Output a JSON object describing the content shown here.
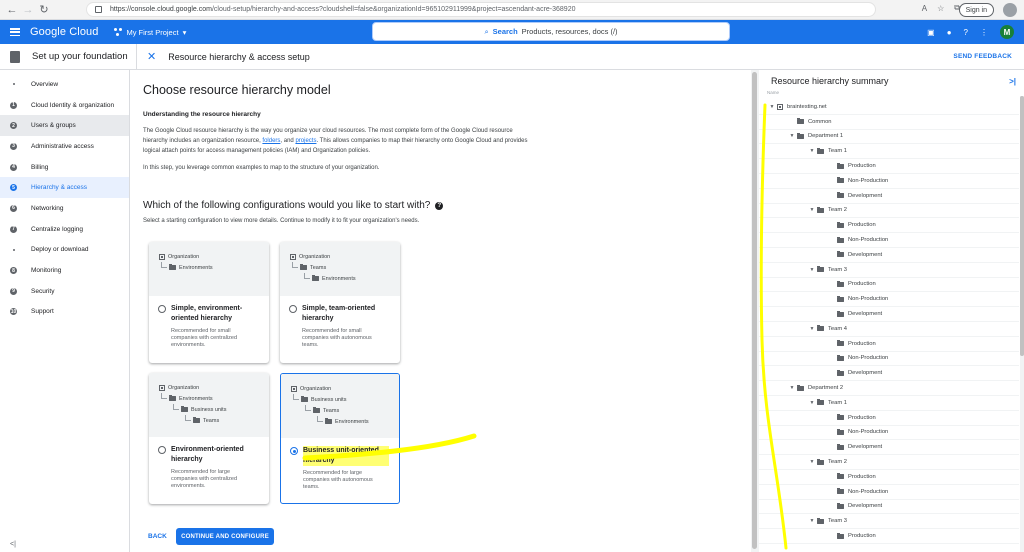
{
  "browser": {
    "url_main": "https://console.cloud.google.com",
    "url_rest": "/cloud-setup/hierarchy-and-access?cloudshell=false&organizationId=965102911999&project=ascendant-acre-368920",
    "signin_label": "Sign in"
  },
  "gcp": {
    "logo": "Google Cloud",
    "project": "My First Project",
    "search_label": "Search",
    "search_placeholder": "Products, resources, docs (/)",
    "avatar_letter": "M"
  },
  "header": {
    "foundation_title": "Set up your foundation",
    "setup_title": "Resource hierarchy & access setup",
    "feedback": "SEND FEEDBACK"
  },
  "sidebar": {
    "steps": [
      {
        "label": "Overview",
        "num": ""
      },
      {
        "label": "Cloud Identity & organization",
        "num": "1"
      },
      {
        "label": "Users & groups",
        "num": "2"
      },
      {
        "label": "Administrative access",
        "num": "3"
      },
      {
        "label": "Billing",
        "num": "4"
      },
      {
        "label": "Hierarchy & access",
        "num": "5"
      },
      {
        "label": "Networking",
        "num": "6"
      },
      {
        "label": "Centralize logging",
        "num": "7"
      },
      {
        "label": "Deploy or download",
        "num": ""
      },
      {
        "label": "Monitoring",
        "num": "8"
      },
      {
        "label": "Security",
        "num": "9"
      },
      {
        "label": "Support",
        "num": "10"
      }
    ],
    "collapse": "<|"
  },
  "main": {
    "title": "Choose resource hierarchy model",
    "understanding_heading": "Understanding the resource hierarchy",
    "para_1": "The Google Cloud resource hierarchy is the way you organize your cloud resources. The most complete form of the Google Cloud resource hierarchy includes an organization resource, ",
    "link_folders": "folders",
    "para_and": ", and ",
    "link_projects": "projects",
    "para_2": ". This allows companies to map their hierarchy onto Google Cloud and provides logical attach points for access management policies (IAM) and Organization policies.",
    "para_step": "In this step, you leverage common examples to map to the structure of your organization.",
    "question": "Which of the following configurations would you like to start with?",
    "question_desc": "Select a starting configuration to view more details. Continue to modify it to fit your organization's needs.",
    "cards": [
      {
        "title": "Simple, environment-oriented hierarchy",
        "desc": "Recommended for small companies with centralized environments.",
        "tree": [
          "Organization",
          "Environments"
        ]
      },
      {
        "title": "Simple, team-oriented hierarchy",
        "desc": "Recommended for small companies with autonomous teams.",
        "tree": [
          "Organization",
          "Teams",
          "Environments"
        ]
      },
      {
        "title": "Environment-oriented hierarchy",
        "desc": "Recommended for large companies with centralized environments.",
        "tree": [
          "Organization",
          "Environments",
          "Business units",
          "Teams"
        ]
      },
      {
        "title": "Business unit-oriented hierarchy",
        "desc": "Recommended for large companies with autonomous teams.",
        "tree": [
          "Organization",
          "Business units",
          "Teams",
          "Environments"
        ]
      }
    ],
    "back": "BACK",
    "continue": "CONTINUE AND CONFIGURE"
  },
  "summary": {
    "title": "Resource hierarchy summary",
    "name_header": "Name",
    "rows": [
      {
        "label": "braintesting.net",
        "level": 0,
        "type": "org",
        "expanded": true
      },
      {
        "label": "Common",
        "level": 1,
        "type": "folder",
        "expanded": false
      },
      {
        "label": "Department 1",
        "level": 1,
        "type": "folder",
        "expanded": true
      },
      {
        "label": "Team 1",
        "level": 2,
        "type": "folder",
        "expanded": true
      },
      {
        "label": "Production",
        "level": 3,
        "type": "folder",
        "expanded": false
      },
      {
        "label": "Non-Production",
        "level": 3,
        "type": "folder",
        "expanded": false
      },
      {
        "label": "Development",
        "level": 3,
        "type": "folder",
        "expanded": false
      },
      {
        "label": "Team 2",
        "level": 2,
        "type": "folder",
        "expanded": true
      },
      {
        "label": "Production",
        "level": 3,
        "type": "folder",
        "expanded": false
      },
      {
        "label": "Non-Production",
        "level": 3,
        "type": "folder",
        "expanded": false
      },
      {
        "label": "Development",
        "level": 3,
        "type": "folder",
        "expanded": false
      },
      {
        "label": "Team 3",
        "level": 2,
        "type": "folder",
        "expanded": true
      },
      {
        "label": "Production",
        "level": 3,
        "type": "folder",
        "expanded": false
      },
      {
        "label": "Non-Production",
        "level": 3,
        "type": "folder",
        "expanded": false
      },
      {
        "label": "Development",
        "level": 3,
        "type": "folder",
        "expanded": false
      },
      {
        "label": "Team 4",
        "level": 2,
        "type": "folder",
        "expanded": true
      },
      {
        "label": "Production",
        "level": 3,
        "type": "folder",
        "expanded": false
      },
      {
        "label": "Non-Production",
        "level": 3,
        "type": "folder",
        "expanded": false
      },
      {
        "label": "Development",
        "level": 3,
        "type": "folder",
        "expanded": false
      },
      {
        "label": "Department 2",
        "level": 1,
        "type": "folder",
        "expanded": true
      },
      {
        "label": "Team 1",
        "level": 2,
        "type": "folder",
        "expanded": true
      },
      {
        "label": "Production",
        "level": 3,
        "type": "folder",
        "expanded": false
      },
      {
        "label": "Non-Production",
        "level": 3,
        "type": "folder",
        "expanded": false
      },
      {
        "label": "Development",
        "level": 3,
        "type": "folder",
        "expanded": false
      },
      {
        "label": "Team 2",
        "level": 2,
        "type": "folder",
        "expanded": true
      },
      {
        "label": "Production",
        "level": 3,
        "type": "folder",
        "expanded": false
      },
      {
        "label": "Non-Production",
        "level": 3,
        "type": "folder",
        "expanded": false
      },
      {
        "label": "Development",
        "level": 3,
        "type": "folder",
        "expanded": false
      },
      {
        "label": "Team 3",
        "level": 2,
        "type": "folder",
        "expanded": true
      },
      {
        "label": "Production",
        "level": 3,
        "type": "folder",
        "expanded": false
      }
    ]
  },
  "colors": {
    "accent": "#1a73e8",
    "highlight": "#ffff00"
  }
}
